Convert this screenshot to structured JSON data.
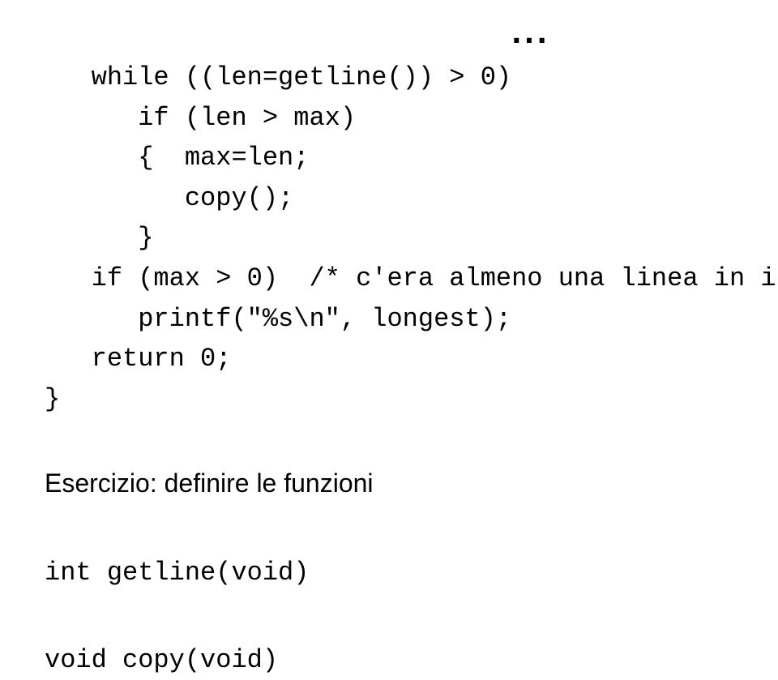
{
  "dots": "...",
  "code": "   while ((len=getline()) > 0)\n      if (len > max)\n      {  max=len;\n         copy();\n      }\n   if (max > 0)  /* c'era almeno una linea in input */\n      printf(\"%s\\n\", longest);\n   return 0;\n}",
  "exercise": {
    "label": "Esercizio:",
    "text": " definire le funzioni"
  },
  "func1": "int getline(void)",
  "func2": "void copy(void)"
}
